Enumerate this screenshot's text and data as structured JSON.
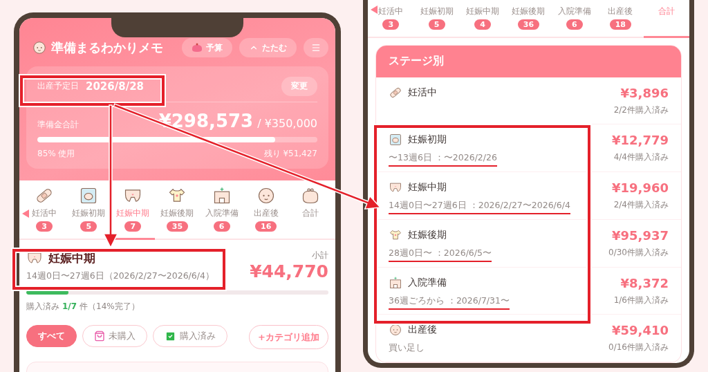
{
  "left_screen": {
    "app_title": "準備まるわかりメモ",
    "header_buttons": [
      {
        "kind": "budget",
        "label": "予算"
      },
      {
        "kind": "collapse",
        "label": "たたむ"
      }
    ],
    "due_date": {
      "label": "出産予定日",
      "value": "2026/8/28",
      "change_button": "変更"
    },
    "budget": {
      "label": "準備金合計",
      "spent": "¥298,573",
      "total": "/ ¥350,000",
      "level": 0.85,
      "used": "85% 使用",
      "remaining": "残り ¥51,427"
    },
    "tabs": [
      {
        "label": "妊活中",
        "count": "3",
        "selected": false
      },
      {
        "label": "妊娠初期",
        "count": "5",
        "selected": false
      },
      {
        "label": "妊娠中期",
        "count": "7",
        "selected": true
      },
      {
        "label": "妊娠後期",
        "count": "35",
        "selected": false
      },
      {
        "label": "入院準備",
        "count": "6",
        "selected": false
      },
      {
        "label": "出産後",
        "count": "16",
        "selected": false
      },
      {
        "label": "合計",
        "selected": false
      }
    ],
    "stage": {
      "name": "妊娠中期",
      "period": "14週0日〜27週6日（2026/2/27〜2026/6/4）",
      "subtotal_label": "小計",
      "subtotal": "¥44,770",
      "level": 0.14,
      "purchased_label": "購入済み",
      "purchased_count": "1/7",
      "purchased_rest": "件（14%完了）"
    },
    "filters": [
      {
        "kind": "all",
        "label": "すべて",
        "selected": true
      },
      {
        "kind": "unpurchased",
        "label": "未購入",
        "selected": false
      },
      {
        "kind": "purchased",
        "label": "購入済み",
        "selected": false
      }
    ],
    "add_category_button": "+カテゴリ追加"
  },
  "right_screen": {
    "tabs": [
      {
        "label": "妊活中",
        "count": "3",
        "selected": false
      },
      {
        "label": "妊娠初期",
        "count": "5",
        "selected": false
      },
      {
        "label": "妊娠中期",
        "count": "4",
        "selected": false
      },
      {
        "label": "妊娠後期",
        "count": "36",
        "selected": false
      },
      {
        "label": "入院準備",
        "count": "6",
        "selected": false
      },
      {
        "label": "出産後",
        "count": "18",
        "selected": false
      },
      {
        "label": "合計",
        "selected": true
      }
    ],
    "stage_summary": {
      "title": "ステージ別",
      "rows": [
        {
          "name": "妊活中",
          "amount": "¥3,896",
          "purchased": "2/2件購入済み",
          "highlighted": false
        },
        {
          "name": "妊娠初期",
          "period": "〜13週6日 ：〜2026/2/26",
          "amount": "¥12,779",
          "purchased": "4/4件購入済み",
          "highlighted": true
        },
        {
          "name": "妊娠中期",
          "period": "14週0日〜27週6日 ：2026/2/27〜2026/6/4",
          "amount": "¥19,960",
          "purchased": "2/4件購入済み",
          "highlighted": true
        },
        {
          "name": "妊娠後期",
          "period": "28週0日〜 ：2026/6/5〜",
          "amount": "¥95,937",
          "purchased": "0/30件購入済み",
          "highlighted": true
        },
        {
          "name": "入院準備",
          "period": "36週ごろから ：2026/7/31〜",
          "amount": "¥8,372",
          "purchased": "1/6件購入済み",
          "highlighted": true
        },
        {
          "name": "出産後",
          "period": "買い足し",
          "amount": "¥59,410",
          "purchased": "0/16件購入済み",
          "highlighted": false
        }
      ]
    }
  }
}
